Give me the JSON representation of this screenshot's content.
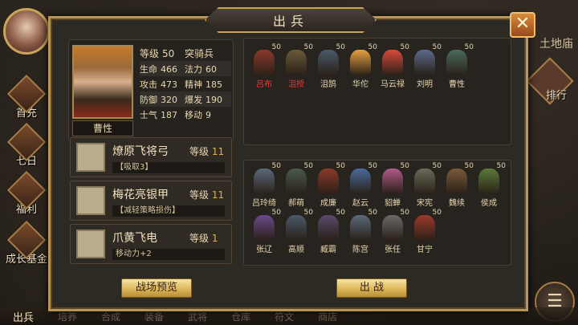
{
  "dialog": {
    "title": "出兵",
    "close_icon": "close-icon"
  },
  "hero": {
    "name": "曹性",
    "level_label": "等级",
    "level": "50",
    "class": "突骑兵",
    "stats": [
      {
        "label1": "生命",
        "value1": "466",
        "label2": "法力",
        "value2": "60"
      },
      {
        "label1": "攻击",
        "value1": "473",
        "label2": "精神",
        "value2": "185"
      },
      {
        "label1": "防御",
        "value1": "320",
        "label2": "爆发",
        "value2": "190"
      },
      {
        "label1": "士气",
        "value1": "187",
        "label2": "移动",
        "value2": "9"
      }
    ]
  },
  "equipment": [
    {
      "name": "燎原飞将弓",
      "level_label": "等级",
      "level": "11",
      "effect": "【吸取3】",
      "icon": "bow-icon"
    },
    {
      "name": "梅花亮银甲",
      "level_label": "等级",
      "level": "11",
      "effect": "【减轻策略损伤】",
      "icon": "armor-icon"
    },
    {
      "name": "爪黄飞电",
      "level_label": "等级",
      "level": "1",
      "effect": "移动力+2",
      "icon": "horse-icon"
    }
  ],
  "buttons": {
    "preview": "战场预览",
    "battle": "出 战"
  },
  "selected_units": [
    {
      "name": "吕布",
      "level": "50",
      "red": true,
      "color": "#8a3a2a"
    },
    {
      "name": "沮授",
      "level": "50",
      "red": true,
      "color": "#6a5a3a"
    },
    {
      "name": "沮鹄",
      "level": "50",
      "red": false,
      "color": "#4a5a6a"
    },
    {
      "name": "华佗",
      "level": "50",
      "red": false,
      "color": "#e6a040"
    },
    {
      "name": "马云禄",
      "level": "50",
      "red": false,
      "color": "#d84a3a"
    },
    {
      "name": "刘明",
      "level": "50",
      "red": false,
      "color": "#5a6a8a"
    },
    {
      "name": "曹性",
      "level": "50",
      "red": false,
      "color": "#4a6a5a"
    }
  ],
  "reserve_units": [
    {
      "name": "吕玲绮",
      "level": "50",
      "color": "#5a6a7a"
    },
    {
      "name": "郝萌",
      "level": "50",
      "color": "#4a5a4a"
    },
    {
      "name": "成廉",
      "level": "50",
      "color": "#8a3a2a"
    },
    {
      "name": "赵云",
      "level": "50",
      "color": "#4a6a9a"
    },
    {
      "name": "貂蝉",
      "level": "50",
      "color": "#b05a8a"
    },
    {
      "name": "宋宪",
      "level": "50",
      "color": "#6a6a5a"
    },
    {
      "name": "魏续",
      "level": "50",
      "color": "#7a5a3a"
    },
    {
      "name": "侯成",
      "level": "50",
      "color": "#5a7a3a"
    },
    {
      "name": "张辽",
      "level": "50",
      "color": "#6a4a8a"
    },
    {
      "name": "高顺",
      "level": "50",
      "color": "#4a5a6a"
    },
    {
      "name": "臧霸",
      "level": "50",
      "color": "#5a4a6a"
    },
    {
      "name": "陈宫",
      "level": "50",
      "color": "#5a6a7a"
    },
    {
      "name": "张任",
      "level": "50",
      "color": "#6a6a6a"
    },
    {
      "name": "甘宁",
      "level": "50",
      "color": "#9a3a2a"
    }
  ],
  "left_nav": [
    "首充",
    "七日",
    "福利",
    "成长基金"
  ],
  "right_nav": {
    "tag": "土地庙",
    "button": "排行"
  },
  "bottom_nav": [
    "出兵",
    "培养",
    "合成",
    "装备",
    "武将",
    "仓库",
    "符文",
    "商店"
  ]
}
